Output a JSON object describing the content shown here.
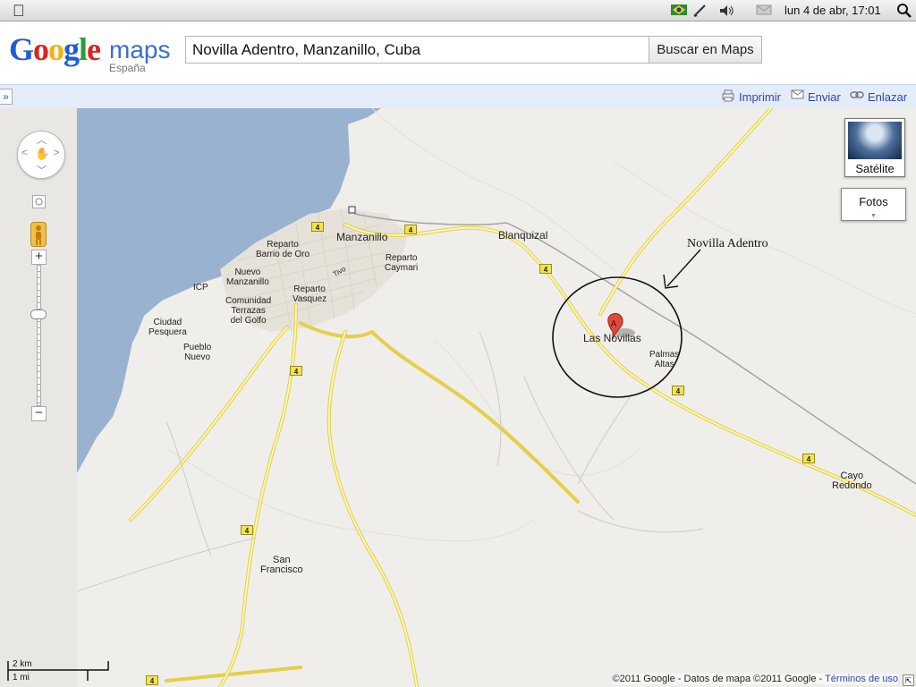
{
  "menubar": {
    "clock": "lun  4 de abr, 17:01"
  },
  "header": {
    "logo_letters": [
      "G",
      "o",
      "o",
      "g",
      "l",
      "e"
    ],
    "maps_word": "maps",
    "region": "España",
    "search_value": "Novilla Adentro, Manzanillo, Cuba",
    "search_button": "Buscar en Maps"
  },
  "toolbar": {
    "expand": "»",
    "print": "Imprimir",
    "send": "Enviar",
    "link": "Enlazar"
  },
  "map": {
    "places": {
      "manzanillo": "Manzanillo",
      "blanquizal": "Blanquizal",
      "reparto_barrio": "Reparto\nBarrio de Oro",
      "reparto_caymari": "Reparto\nCaymari",
      "tivo": "Tivo",
      "icp": "ICP",
      "nuevo_manzanillo": "Nuevo\nManzanillo",
      "reparto_vasquez": "Reparto\nVasquez",
      "comunidad": "Comunidad\nTerrazas\ndel Golfo",
      "ciudad_pesquera": "Ciudad\nPesquera",
      "pueblo_nuevo": "Pueblo\nNuevo",
      "las_novillas": "Las Novillas",
      "palmas_altas": "Palmas\nAltas",
      "cayo_redondo": "Cayo\nRedondo",
      "san_francisco": "San\nFrancisco"
    },
    "road_number": "4",
    "marker_letter": "A",
    "annotation": "Novilla Adentro",
    "map_type": {
      "satellite": "Satélite",
      "photos": "Fotos"
    },
    "scale": {
      "km": "2 km",
      "mi": "1 mi"
    },
    "copyright": "©2011 Google - Datos de mapa ©2011 Google - ",
    "terms": "Términos de uso"
  },
  "colors": {
    "water": "#98b2d0",
    "land": "#f0eeea",
    "road": "#f5e66a",
    "toolbar": "#e5ecf9",
    "link": "#2a48b0"
  }
}
